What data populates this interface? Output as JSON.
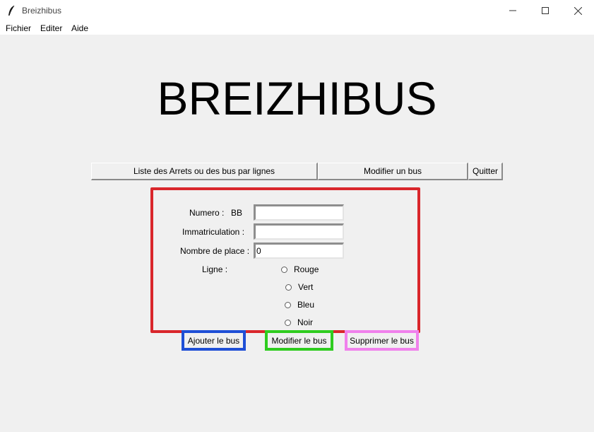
{
  "window": {
    "title": "Breizhibus",
    "app_icon": "feather-icon",
    "controls": [
      "minimize-icon",
      "maximize-icon",
      "close-icon"
    ]
  },
  "menu": {
    "items": [
      "Fichier",
      "Editer",
      "Aide"
    ]
  },
  "main": {
    "title": "BREIZHIBUS"
  },
  "nav": {
    "list_label": "Liste des Arrets ou des bus par lignes",
    "modify_label": "Modifier un bus",
    "quit_label": "Quitter"
  },
  "form": {
    "numero_label": "Numero :",
    "numero_prefix": "BB",
    "numero_value": "",
    "immatriculation_label": "Immatriculation :",
    "immatriculation_value": "",
    "places_label": "Nombre de place :",
    "places_value": "0",
    "ligne_label": "Ligne :",
    "lignes": [
      "Rouge",
      "Vert",
      "Bleu",
      "Noir"
    ]
  },
  "actions": {
    "add_label": "Ajouter le bus",
    "modify_label": "Modifier le bus",
    "delete_label": "Supprimer le bus"
  },
  "colors": {
    "form_outline": "#d9262b",
    "add_outline": "#1f4fd6",
    "modify_outline": "#2fcc1f",
    "delete_outline": "#f081ec"
  }
}
